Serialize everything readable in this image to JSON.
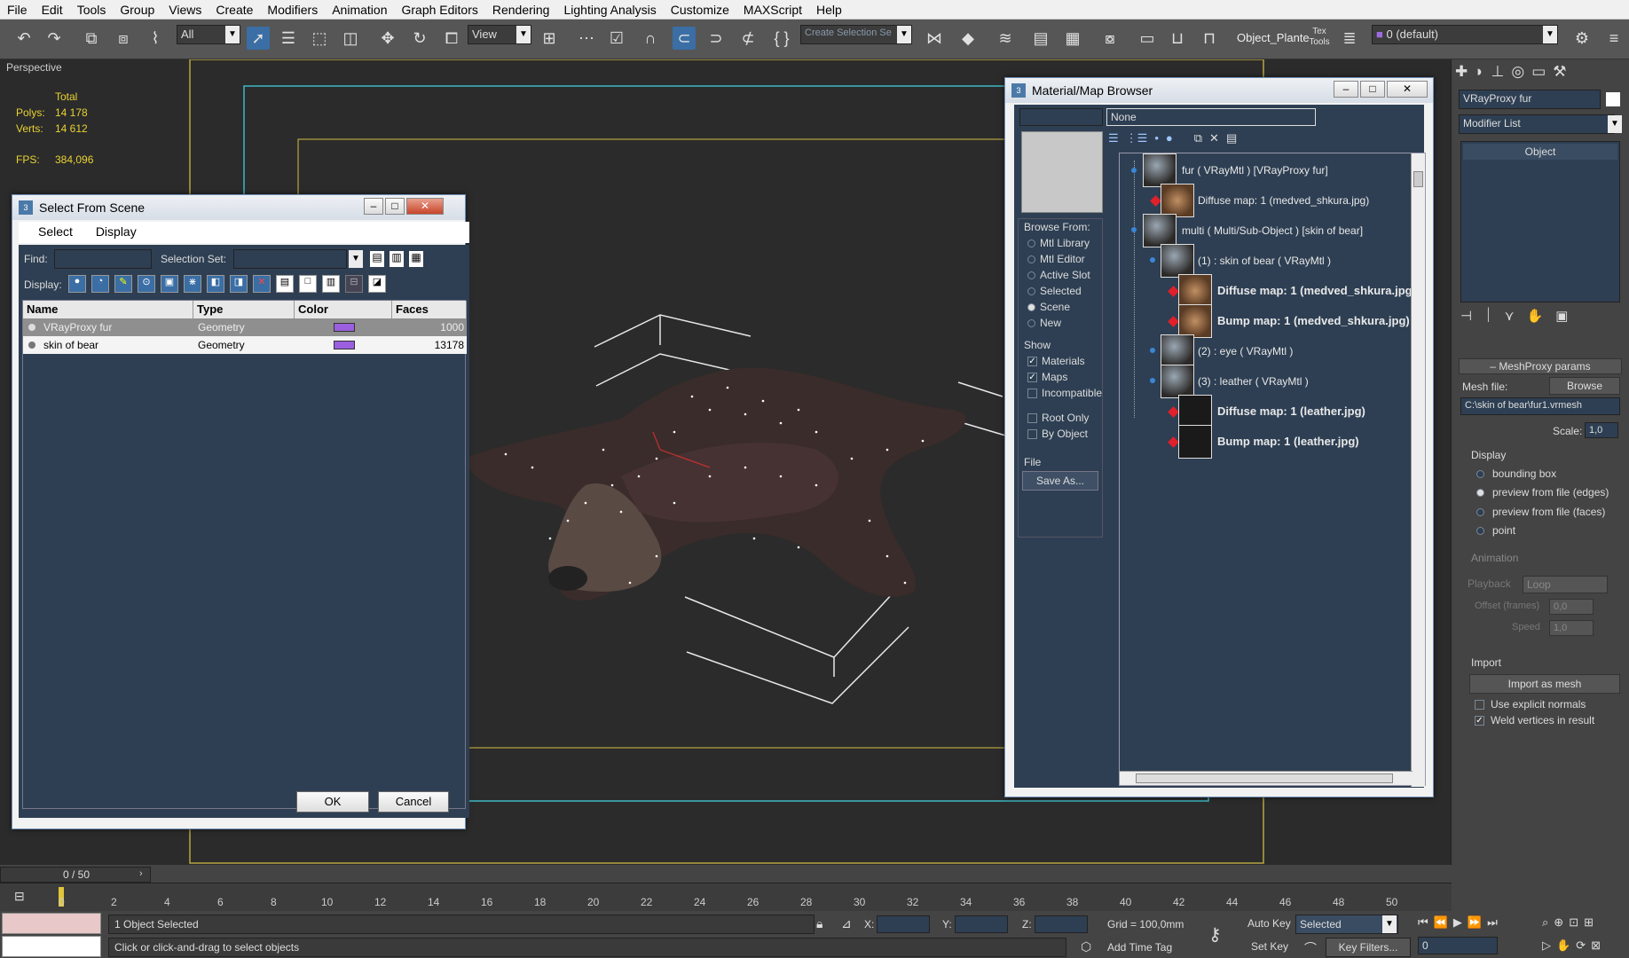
{
  "menu": [
    "File",
    "Edit",
    "Tools",
    "Group",
    "Views",
    "Create",
    "Modifiers",
    "Animation",
    "Graph Editors",
    "Rendering",
    "Lighting Analysis",
    "Customize",
    "MAXScript",
    "Help"
  ],
  "toolbar": {
    "filter": "All",
    "coord": "View",
    "selection_set_placeholder": "Create Selection Se",
    "object_label": "Object_Plante",
    "layer": "0 (default)"
  },
  "viewport": {
    "label": "Perspective",
    "total": "Total",
    "polys_label": "Polys:",
    "polys": "14 178",
    "verts_label": "Verts:",
    "verts": "14 612",
    "fps_label": "FPS:",
    "fps": "384,096"
  },
  "select_from_scene": {
    "title": "Select From Scene",
    "menu": [
      "Select",
      "Display"
    ],
    "find_label": "Find:",
    "selection_set_label": "Selection Set:",
    "display_label": "Display:",
    "columns": [
      "Name",
      "Type",
      "Color",
      "Faces"
    ],
    "rows": [
      {
        "name": "VRayProxy fur",
        "type": "Geometry",
        "color": "#9b5fe0",
        "faces": "1000"
      },
      {
        "name": "skin of bear",
        "type": "Geometry",
        "color": "#9b5fe0",
        "faces": "13178"
      }
    ],
    "ok": "OK",
    "cancel": "Cancel"
  },
  "material_browser": {
    "title": "Material/Map Browser",
    "name_field": "None",
    "browse_from_label": "Browse From:",
    "browse_from": [
      {
        "label": "Mtl Library",
        "on": false
      },
      {
        "label": "Mtl Editor",
        "on": false
      },
      {
        "label": "Active Slot",
        "on": false
      },
      {
        "label": "Selected",
        "on": false
      },
      {
        "label": "Scene",
        "on": true
      },
      {
        "label": "New",
        "on": false
      }
    ],
    "show_label": "Show",
    "show": [
      {
        "label": "Materials",
        "on": true
      },
      {
        "label": "Maps",
        "on": true
      },
      {
        "label": "Incompatible",
        "on": false
      }
    ],
    "root_only": "Root Only",
    "by_object": "By Object",
    "file_label": "File",
    "save_as": "Save As...",
    "tree": [
      {
        "text": "fur  ( VRayMtl )  [VRayProxy fur]",
        "bold": false
      },
      {
        "text": "Diffuse map: 1 (medved_shkura.jpg)",
        "bold": false
      },
      {
        "text": "multi  ( Multi/Sub-Object )  [skin of bear]",
        "bold": false
      },
      {
        "text": "(1) : skin of bear  ( VRayMtl )",
        "bold": false
      },
      {
        "text": "Diffuse map: 1 (medved_shkura.jpg)",
        "bold": true
      },
      {
        "text": "Bump map: 1 (medved_shkura.jpg)",
        "bold": true
      },
      {
        "text": "(2) : eye  ( VRayMtl )",
        "bold": false
      },
      {
        "text": "(3) : leather  ( VRayMtl )",
        "bold": false
      },
      {
        "text": "Diffuse map: 1 (leather.jpg)",
        "bold": true
      },
      {
        "text": "Bump map: 1 (leather.jpg)",
        "bold": true
      }
    ]
  },
  "command_panel": {
    "object_name": "VRayProxy fur",
    "modifier_list": "Modifier List",
    "stack_item": "Object",
    "rollout": "MeshProxy params",
    "mesh_file_label": "Mesh file:",
    "browse": "Browse",
    "mesh_file": "C:\\skin of bear\\fur1.vrmesh",
    "scale_label": "Scale:",
    "scale": "1,0",
    "display_label": "Display",
    "display": [
      {
        "label": "bounding box",
        "on": false
      },
      {
        "label": "preview from file (edges)",
        "on": true
      },
      {
        "label": "preview from file (faces)",
        "on": false
      },
      {
        "label": "point",
        "on": false
      }
    ],
    "animation_label": "Animation",
    "playback_label": "Playback",
    "playback": "Loop",
    "offset_label": "Offset (frames)",
    "offset": "0,0",
    "speed_label": "Speed",
    "speed": "1,0",
    "import_label": "Import",
    "import_btn": "Import as mesh",
    "explicit_normals": "Use explicit normals",
    "weld": "Weld vertices in result"
  },
  "timeline": {
    "frame": "0 / 50",
    "ticks": [
      "0",
      "2",
      "4",
      "6",
      "8",
      "10",
      "12",
      "14",
      "16",
      "18",
      "20",
      "22",
      "24",
      "26",
      "28",
      "30",
      "32",
      "34",
      "36",
      "38",
      "40",
      "42",
      "44",
      "46",
      "48",
      "50"
    ]
  },
  "status": {
    "selected": "1 Object Selected",
    "hint": "Click or click-and-drag to select objects",
    "x_label": "X:",
    "y_label": "Y:",
    "z_label": "Z:",
    "grid": "Grid = 100,0mm",
    "add_time_tag": "Add Time Tag",
    "auto_key": "Auto Key",
    "set_key": "Set Key",
    "key_mode": "Selected",
    "key_filters": "Key Filters...",
    "frame": "0"
  }
}
